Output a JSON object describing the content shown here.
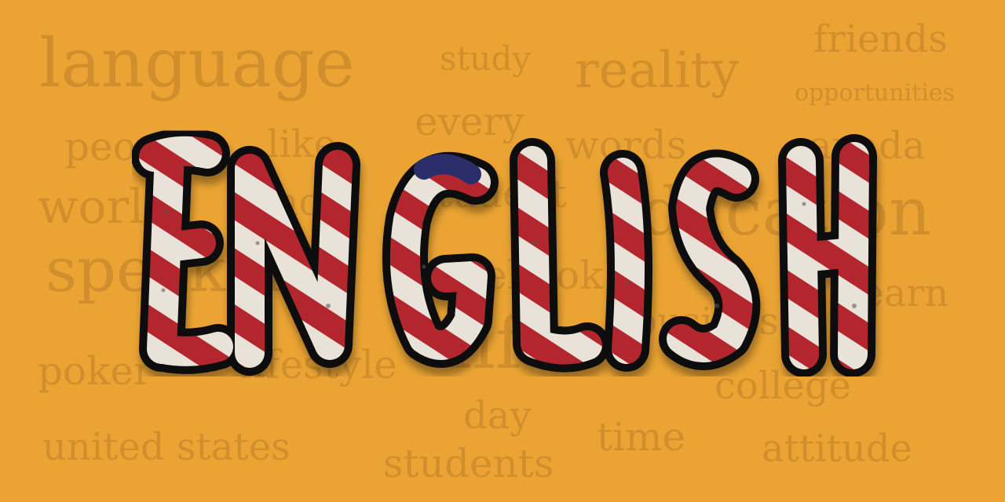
{
  "background_color": "#EBA433",
  "background_word_color": "#C8892A",
  "title": {
    "text": "ENGLISH",
    "letters": [
      "E",
      "N",
      "G",
      "L",
      "I",
      "S",
      "H"
    ],
    "fill_style": "american-flag-stripes",
    "colors": {
      "outline": "#111111",
      "red": "#B3262E",
      "white": "#E8E2D8",
      "blue": "#2C2F6B"
    }
  },
  "background_words": {
    "language": "language",
    "study": "study",
    "reality": "reality",
    "friends": "friends",
    "opportunities": "opportunities",
    "every": "every",
    "people": "people",
    "like": "like",
    "words": "words",
    "canada": "canada",
    "world": "world",
    "school": "school",
    "student": "student",
    "education": "education",
    "speakers": "speakers",
    "facebook": "facebook",
    "learn": "learn",
    "business": "business",
    "life": "life",
    "poker": "poker",
    "lifestyle": "lifestyle",
    "college": "college",
    "day": "day",
    "time": "time",
    "united_states": "united states",
    "students": "students",
    "attitude": "attitude"
  }
}
